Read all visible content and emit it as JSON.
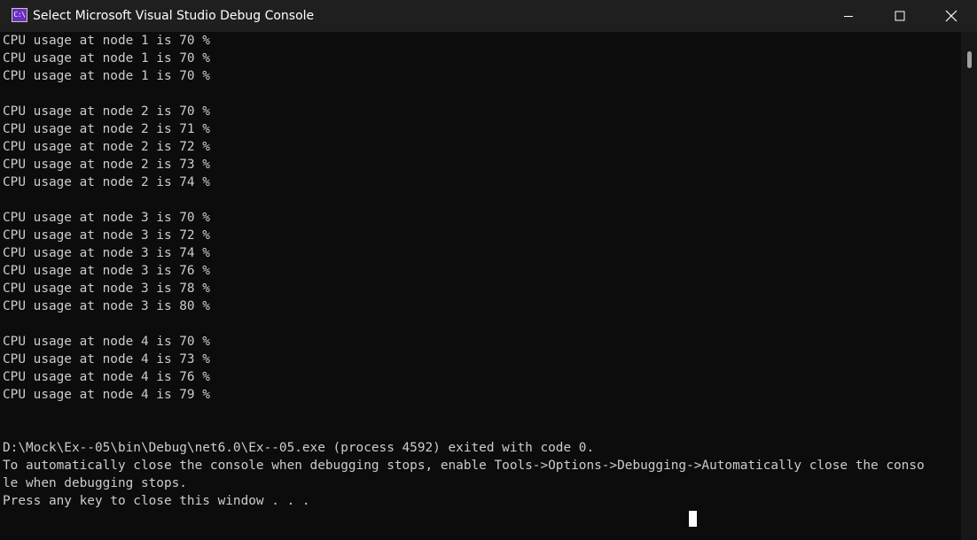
{
  "window": {
    "title": "Select Microsoft Visual Studio Debug Console",
    "icon_text": "C:\\",
    "icon": "console-app-icon",
    "controls": [
      "minimize-icon",
      "maximize-icon",
      "close-icon"
    ]
  },
  "console": {
    "lines": [
      "CPU usage at node 1 is 70 %",
      "CPU usage at node 1 is 70 %",
      "CPU usage at node 1 is 70 %",
      "",
      "CPU usage at node 2 is 70 %",
      "CPU usage at node 2 is 71 %",
      "CPU usage at node 2 is 72 %",
      "CPU usage at node 2 is 73 %",
      "CPU usage at node 2 is 74 %",
      "",
      "CPU usage at node 3 is 70 %",
      "CPU usage at node 3 is 72 %",
      "CPU usage at node 3 is 74 %",
      "CPU usage at node 3 is 76 %",
      "CPU usage at node 3 is 78 %",
      "CPU usage at node 3 is 80 %",
      "",
      "CPU usage at node 4 is 70 %",
      "CPU usage at node 4 is 73 %",
      "CPU usage at node 4 is 76 %",
      "CPU usage at node 4 is 79 %",
      "",
      "",
      "D:\\Mock\\Ex--05\\bin\\Debug\\net6.0\\Ex--05.exe (process 4592) exited with code 0.",
      "To automatically close the console when debugging stops, enable Tools->Options->Debugging->Automatically close the conso",
      "le when debugging stops.",
      "Press any key to close this window . . ."
    ]
  },
  "colors": {
    "background": "#0c0c0c",
    "titlebar": "#1f1f1f",
    "text": "#cccccc",
    "title_text": "#ffffff"
  }
}
